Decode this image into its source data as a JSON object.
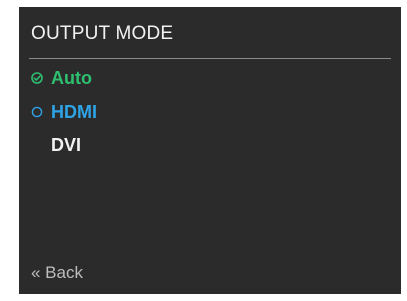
{
  "panel": {
    "title": "OUTPUT MODE",
    "items": [
      {
        "label": "Auto",
        "state": "selected",
        "icon": "check-circle-icon",
        "color": "#2fbf71"
      },
      {
        "label": "HDMI",
        "state": "focused",
        "icon": "ring-icon",
        "color": "#2ea3e6"
      },
      {
        "label": "DVI",
        "state": "normal",
        "icon": "",
        "color": "#f2f2f2"
      }
    ],
    "back_label": "« Back"
  }
}
